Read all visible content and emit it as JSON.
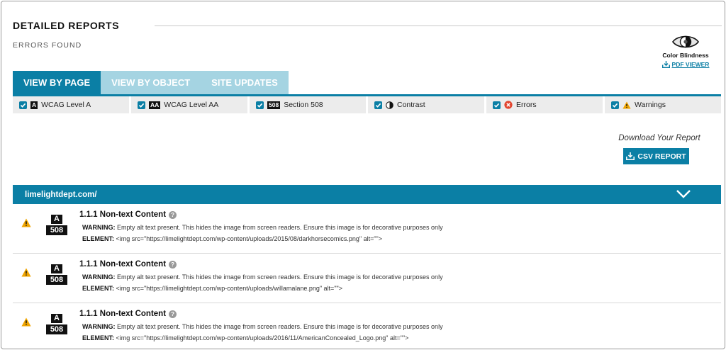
{
  "header": {
    "title": "DETAILED REPORTS",
    "subtitle": "ERRORS FOUND"
  },
  "color_blindness": {
    "label": "Color Blindness",
    "pdf_link": "PDF VIEWER"
  },
  "tabs": [
    {
      "label": "VIEW BY PAGE",
      "active": true
    },
    {
      "label": "VIEW BY OBJECT",
      "active": false
    },
    {
      "label": "SITE UPDATES",
      "active": false
    }
  ],
  "filters": [
    {
      "badge": "A",
      "label": "WCAG Level A",
      "checked": true
    },
    {
      "badge": "AA",
      "label": "WCAG Level AA",
      "checked": true
    },
    {
      "badge": "508",
      "label": "Section 508",
      "checked": true
    },
    {
      "icon": "contrast-icon",
      "label": "Contrast",
      "checked": true
    },
    {
      "icon": "error-icon",
      "label": "Errors",
      "checked": true
    },
    {
      "icon": "warning-icon",
      "label": "Warnings",
      "checked": true
    }
  ],
  "download": {
    "caption": "Download Your Report",
    "csv_label": "CSV REPORT"
  },
  "site": {
    "name": "limelightdept.com/"
  },
  "issues": [
    {
      "level_badge": "A",
      "section_badge": "508",
      "criterion": "1.1.1 Non-text Content",
      "help": "?",
      "warning_label": "WARNING:",
      "warning_text": "Empty alt text present. This hides the image from screen readers. Ensure this image is for decorative purposes only",
      "element_label": "ELEMENT:",
      "element_text": "<img src=\"https://limelightdept.com/wp-content/uploads/2015/08/darkhorsecomics.png\" alt=\"\">"
    },
    {
      "level_badge": "A",
      "section_badge": "508",
      "criterion": "1.1.1 Non-text Content",
      "help": "?",
      "warning_label": "WARNING:",
      "warning_text": "Empty alt text present. This hides the image from screen readers. Ensure this image is for decorative purposes only",
      "element_label": "ELEMENT:",
      "element_text": "<img src=\"https://limelightdept.com/wp-content/uploads/willamalane.png\" alt=\"\">"
    },
    {
      "level_badge": "A",
      "section_badge": "508",
      "criterion": "1.1.1 Non-text Content",
      "help": "?",
      "warning_label": "WARNING:",
      "warning_text": "Empty alt text present. This hides the image from screen readers. Ensure this image is for decorative purposes only",
      "element_label": "ELEMENT:",
      "element_text": "<img src=\"https://limelightdept.com/wp-content/uploads/2016/11/AmericanConcealed_Logo.png\" alt=\"\">"
    }
  ],
  "colors": {
    "accent": "#0b7fa5",
    "tab_inactive": "#a5d4e2",
    "warning": "#f0a500",
    "error": "#e2452f"
  }
}
